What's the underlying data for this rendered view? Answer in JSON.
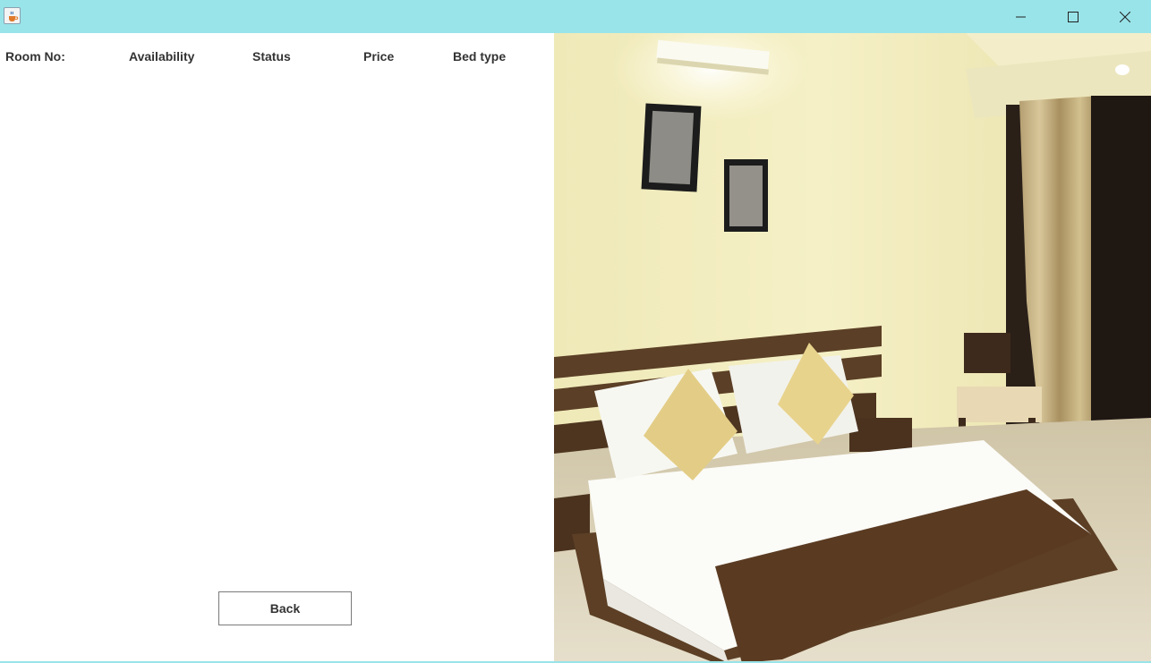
{
  "window": {
    "icon": "java-cup-icon",
    "controls": [
      "minimize-icon",
      "maximize-icon",
      "close-icon"
    ],
    "titlebar_color": "#99e4e9"
  },
  "table": {
    "headers": {
      "room_no": "Room No:",
      "availability": "Availability",
      "status": "Status",
      "price": "Price",
      "bed_type": "Bed type"
    },
    "rows": []
  },
  "actions": {
    "back_label": "Back"
  },
  "image": {
    "subject": "hotel-room-photo"
  }
}
